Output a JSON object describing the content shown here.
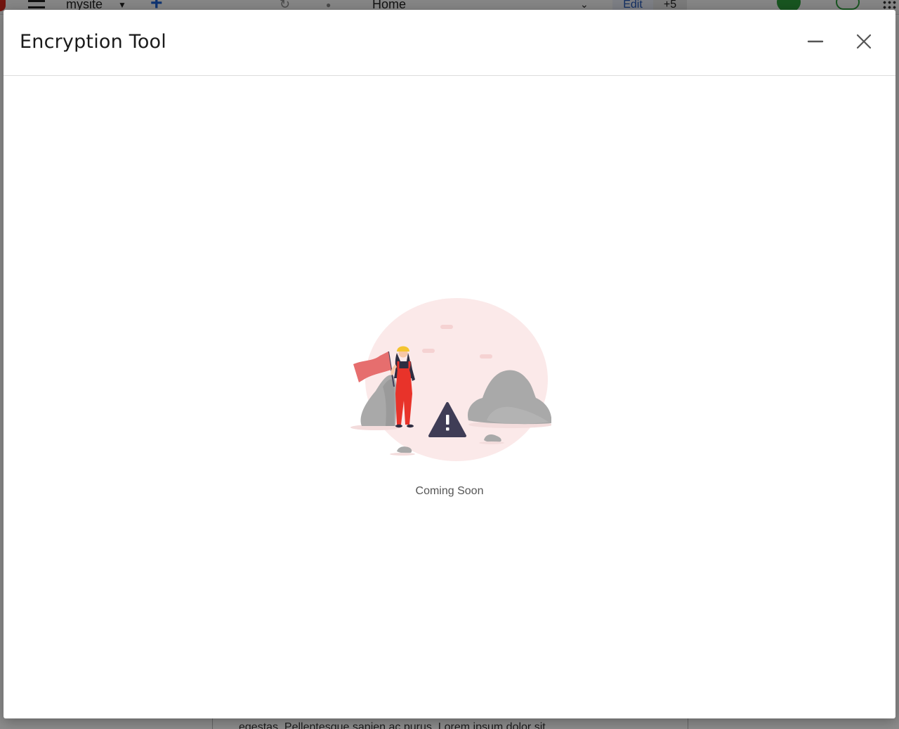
{
  "background": {
    "site_selector": "mysite",
    "page_selector": "Home",
    "edit_label": "Edit",
    "more_count": "+5",
    "body_text": "egestas. Pellentesque sapien ac purus. Lorem ipsum dolor sit"
  },
  "modal": {
    "title": "Encryption Tool",
    "minimize_icon": "minimize-icon",
    "close_icon": "close-icon",
    "status_text": "Coming Soon",
    "illustration": "under-construction-illustration"
  },
  "colors": {
    "accent_red": "#e8332a",
    "flag": "#e66e6e",
    "bubble": "#fbe9e9",
    "rock": "#a9a9a9",
    "warning": "#3f3d56"
  }
}
